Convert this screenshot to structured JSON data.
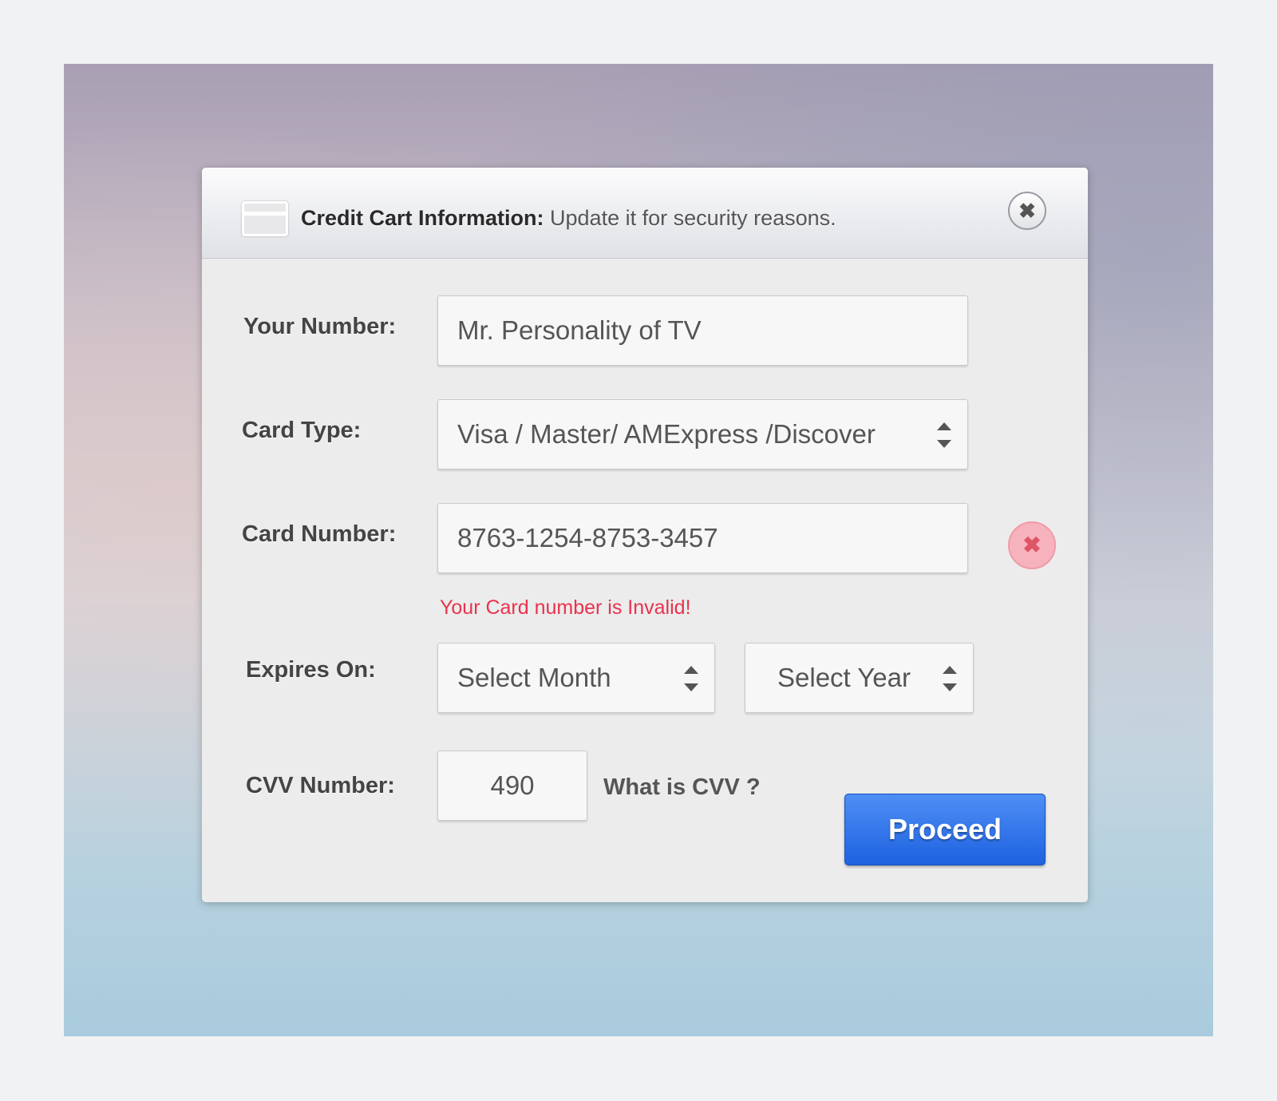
{
  "header": {
    "title_bold": "Credit Cart Information:",
    "title_rest": " Update it for security reasons.",
    "close_icon": "close-icon"
  },
  "form": {
    "your_number": {
      "label": "Your Number:",
      "value": "Mr. Personality of TV"
    },
    "card_type": {
      "label": "Card Type:",
      "value": "Visa / Master/ AMExpress /Discover"
    },
    "card_number": {
      "label": "Card Number:",
      "value": "8763-1254-8753-3457",
      "error": "Your Card number is Invalid!"
    },
    "expires": {
      "label": "Expires On:",
      "month": "Select Month",
      "year": "Select Year"
    },
    "cvv": {
      "label": "CVV Number:",
      "value": "490",
      "help": "What is CVV ?"
    }
  },
  "actions": {
    "proceed": "Proceed"
  },
  "colors": {
    "accent": "#2f74ea",
    "error": "#e8334d"
  }
}
